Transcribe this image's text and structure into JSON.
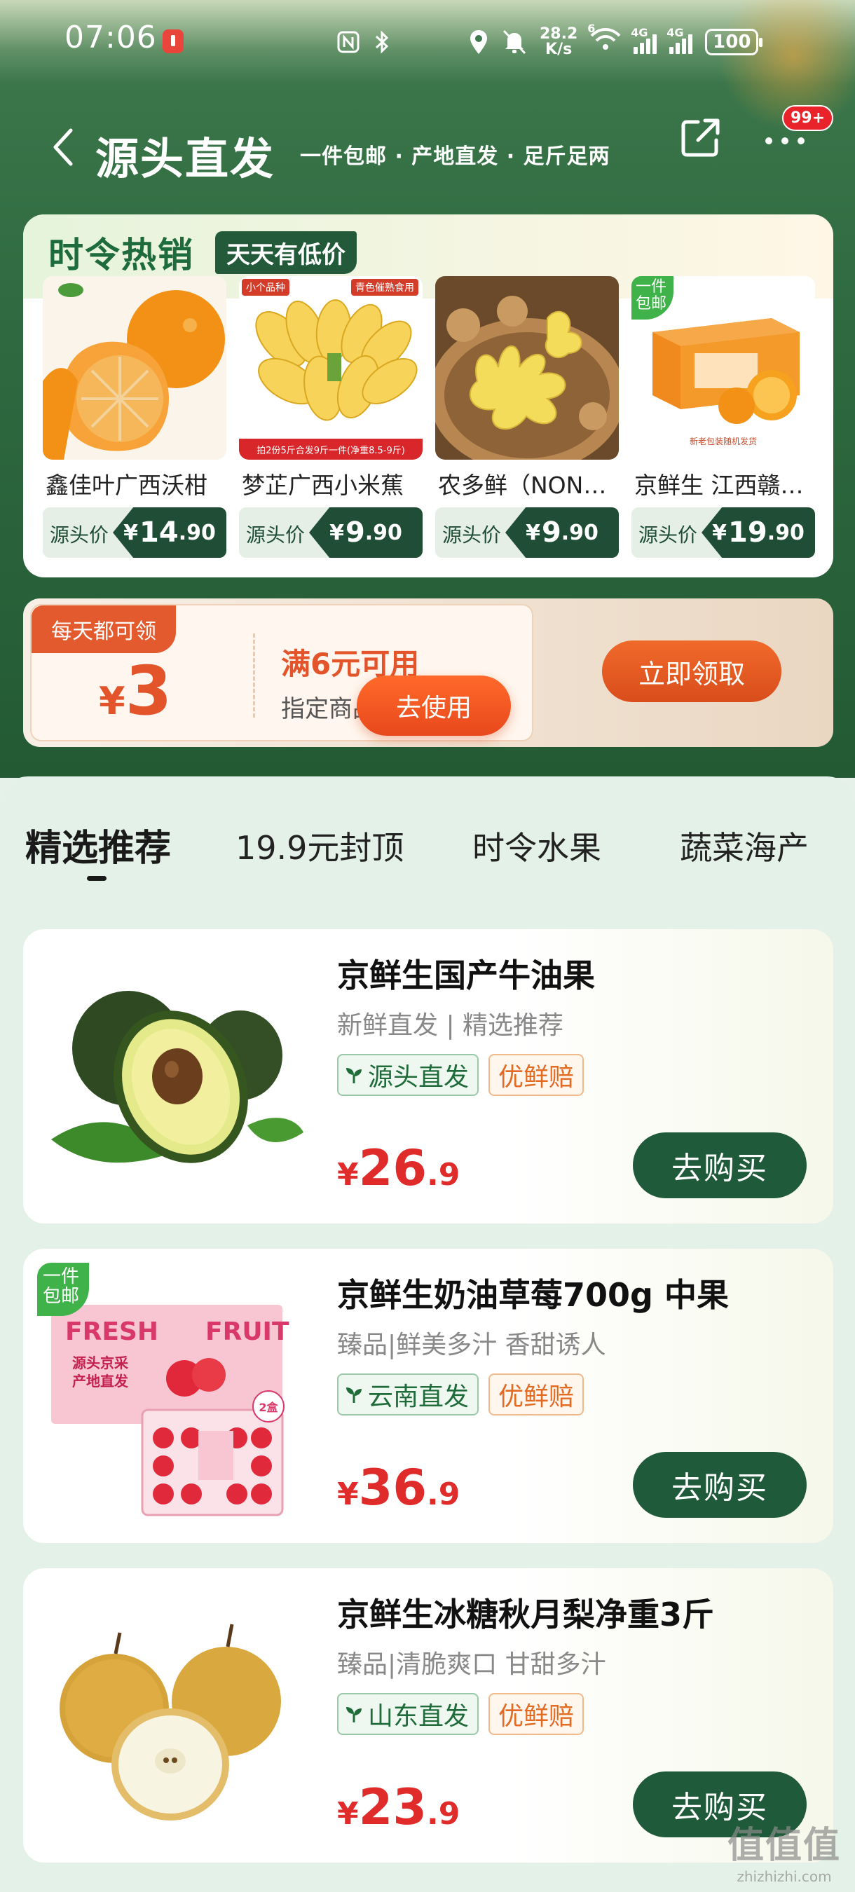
{
  "status_bar": {
    "time": "07:06",
    "net_speed_value": "28.2",
    "net_speed_unit": "K/s",
    "wifi_label": "6",
    "signal1_label": "4G",
    "signal2_label": "4G",
    "battery": "100"
  },
  "header": {
    "title": "源头直发",
    "subtitle": "一件包邮 · 产地直发 · 足斤足两",
    "message_badge": "99+"
  },
  "hot_sale": {
    "title": "时令热销",
    "tag": "天天有低价",
    "price_label": "源头价",
    "currency": "¥",
    "items": [
      {
        "name": "鑫佳叶广西沃柑",
        "price_int": "14",
        "price_dec": ".90"
      },
      {
        "name": "梦芷广西小米蕉",
        "price_int": "9",
        "price_dec": ".90",
        "chip1": "小个品种",
        "chip2": "青色催熟食用",
        "strip": "拍2份5斤合发9斤一件(净重8.5-9斤)"
      },
      {
        "name": "农多鲜（NONGDUOXIAN）生姜",
        "price_int": "9",
        "price_dec": ".90"
      },
      {
        "name": "京鲜生 江西赣南脐橙",
        "price_int": "19",
        "price_dec": ".90",
        "mini_tag_1": "一件",
        "mini_tag_2": "包邮",
        "box_caption": "新老包装随机发货"
      }
    ]
  },
  "coupon": {
    "flag": "每天都可领",
    "currency": "¥",
    "amount": "3",
    "condition": "满6元可用",
    "scope": "指定商品",
    "use_button": "去使用",
    "claim_button": "立即领取"
  },
  "tabs": [
    {
      "label": "精选推荐",
      "active": true
    },
    {
      "label": "19.9元封顶",
      "active": false
    },
    {
      "label": "时令水果",
      "active": false
    },
    {
      "label": "蔬菜海产",
      "active": false
    }
  ],
  "products": [
    {
      "name": "京鲜生国产牛油果",
      "desc": "新鲜直发 | 精选推荐",
      "origin_tag": "源头直发",
      "guarantee_tag": "优鲜赔",
      "currency": "¥",
      "price_int": "26",
      "price_dec": ".9",
      "buy_label": "去购买"
    },
    {
      "name": "京鲜生奶油草莓700g 中果",
      "desc": "臻品|鲜美多汁 香甜诱人",
      "origin_tag": "云南直发",
      "guarantee_tag": "优鲜赔",
      "currency": "¥",
      "price_int": "36",
      "price_dec": ".9",
      "buy_label": "去购买",
      "mini_tag_1": "一件",
      "mini_tag_2": "包邮",
      "box_text_1": "FRESH",
      "box_text_2": "FRUIT",
      "box_text_3": "源头京采",
      "box_text_4": "产地直发",
      "box_count": "2盒"
    },
    {
      "name": "京鲜生冰糖秋月梨净重3斤",
      "desc": "臻品|清脆爽口 甘甜多汁",
      "origin_tag": "山东直发",
      "guarantee_tag": "优鲜赔",
      "currency": "¥",
      "price_int": "23",
      "price_dec": ".9",
      "buy_label": "去购买"
    }
  ],
  "watermark": {
    "big": "值值值",
    "small": "zhizhizhi.com"
  }
}
